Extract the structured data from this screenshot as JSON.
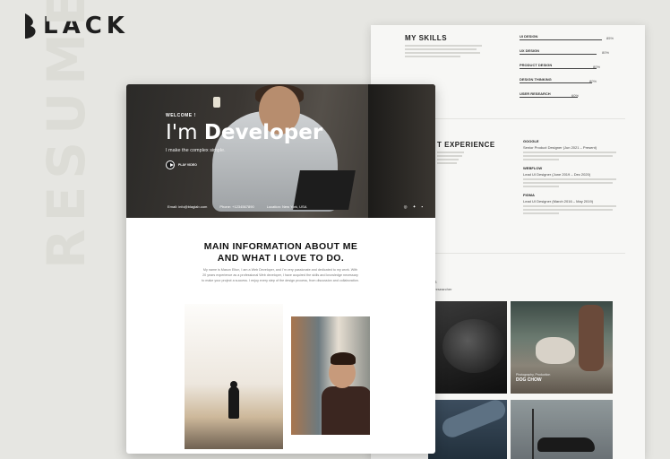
{
  "brand": {
    "logo_text": "LACK",
    "logo_icon": "leaf-b-icon"
  },
  "background_word": "RESUME",
  "back_card": {
    "skills_title": "MY SKILLS",
    "skills": [
      {
        "name": "UI DESIGN",
        "pct": "85%",
        "level": 0.85
      },
      {
        "name": "UX DESIGN",
        "pct": "80%",
        "level": 0.8
      },
      {
        "name": "PRODUCT DESIGN",
        "pct": "80%",
        "level": 0.8
      },
      {
        "name": "DESIGN THINKING",
        "pct": "80%",
        "level": 0.75
      },
      {
        "name": "USER RESEARCH",
        "pct": "60%",
        "level": 0.6
      }
    ],
    "experience_title": "T EXPERIENCE",
    "jobs": [
      {
        "company": "GOOGLE",
        "role": "Senior Product Designer (Jun 2021 – Present)"
      },
      {
        "company": "WEBFLOW",
        "role": "Lead UI Designer (June 2019 – Dec 2020)"
      },
      {
        "company": "FIGMA",
        "role": "Lead UI Designer (March 2016 – May 2019)"
      }
    ],
    "portfolio_title": "NS",
    "portfolio_sub": "a researcher",
    "tiles": [
      {
        "label": "ES",
        "category": ""
      },
      {
        "label": "DOG CHOW",
        "category": "Photography, Production"
      },
      {
        "label": "",
        "category": ""
      },
      {
        "label": "",
        "category": ""
      }
    ]
  },
  "hero": {
    "welcome": "WELCOME !",
    "title_prefix": "I'm ",
    "title_bold": "Developer",
    "subtitle": "I make the complex simple.",
    "play_label": "PLAY VIDEO",
    "email": "Email: info@blaglab.com",
    "phone": "Phone: +1234567890",
    "location": "Location: New York, USA",
    "social_icons": [
      "instagram-icon",
      "twitter-icon",
      "linkedin-icon"
    ]
  },
  "about": {
    "title_line1": "MAIN INFORMATION ABOUT ME",
    "title_line2": "AND WHAT I LOVE TO DO.",
    "text": "My name is Mason Elton, I am a Web Developer, and I'm very passionate and dedicated to my work. With 20 years experience as a professional Web developer, I have acquired the skills and knowledge necessary to make your project a success. I enjoy every step of the design process, from discussion and collaboration."
  }
}
